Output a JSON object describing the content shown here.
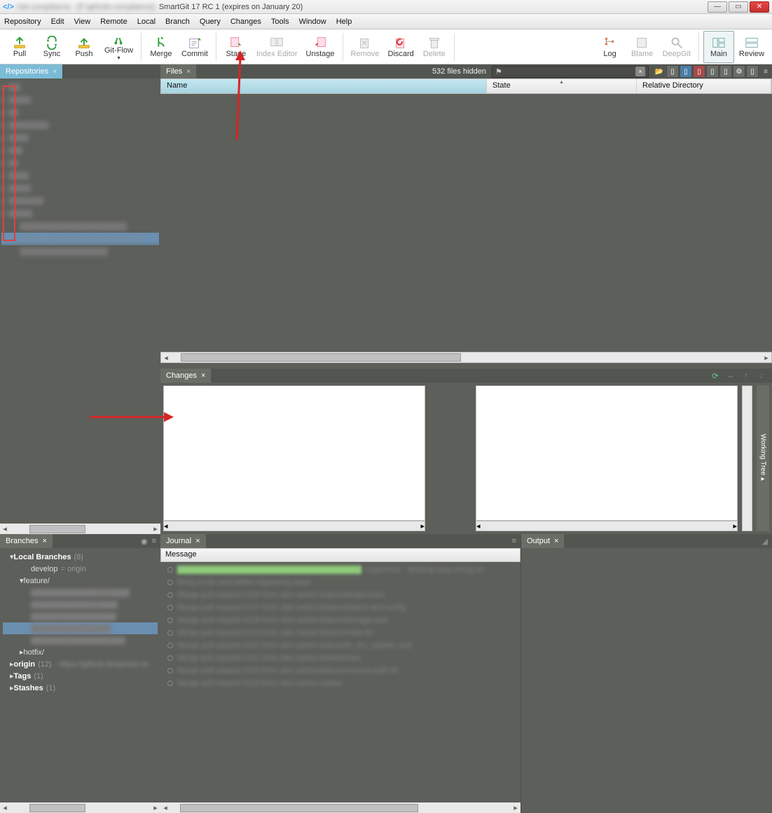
{
  "title": "SmartGit 17 RC 1 (expires on January 20)",
  "title_prefix_blur": "risk-compliance - [F:\\git\\risk-compliance] - ",
  "menus": [
    "Repository",
    "Edit",
    "View",
    "Remote",
    "Local",
    "Branch",
    "Query",
    "Changes",
    "Tools",
    "Window",
    "Help"
  ],
  "toolbar": {
    "pull": "Pull",
    "sync": "Sync",
    "push": "Push",
    "gitflow": "Git-Flow",
    "merge": "Merge",
    "commit": "Commit",
    "stage": "Stage",
    "index_editor": "Index Editor",
    "unstage": "Unstage",
    "remove": "Remove",
    "discard": "Discard",
    "delete": "Delete",
    "log": "Log",
    "blame": "Blame",
    "deepgit": "DeepGit",
    "main": "Main",
    "review": "Review"
  },
  "panels": {
    "repositories": "Repositories",
    "files": "Files",
    "changes": "Changes",
    "branches": "Branches",
    "journal": "Journal",
    "output": "Output",
    "working_tree": "Working Tree"
  },
  "files": {
    "hidden_status": "532 files hidden",
    "columns": {
      "name": "Name",
      "state": "State",
      "reldir": "Relative Directory"
    }
  },
  "branches": {
    "local": "Local Branches",
    "local_count": "(8)",
    "develop": "develop",
    "develop_remote": "= origin",
    "feature": "feature/",
    "hotfix": "hotfix/",
    "origin": "origin",
    "origin_count": "(12)",
    "origin_remote": "- https://github.dowjones.ne",
    "tags": "Tags",
    "tags_count": "(1)",
    "stashes": "Stashes",
    "stashes_count": "(1)"
  },
  "journal": {
    "message": "Message"
  }
}
